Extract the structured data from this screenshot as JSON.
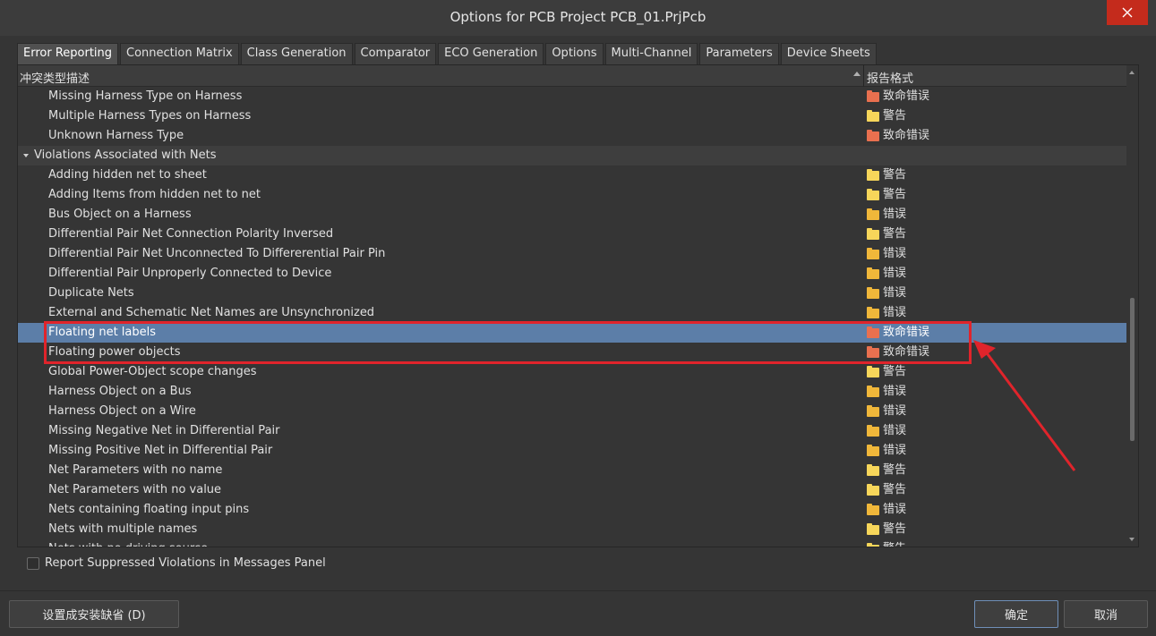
{
  "window": {
    "title": "Options for PCB Project PCB_01.PrjPcb"
  },
  "tabs": [
    "Error Reporting",
    "Connection Matrix",
    "Class Generation",
    "Comparator",
    "ECO Generation",
    "Options",
    "Multi-Channel",
    "Parameters",
    "Device Sheets"
  ],
  "active_tab": "Error Reporting",
  "table": {
    "col_description": "冲突类型描述",
    "col_report_mode": "报告格式",
    "rows": [
      {
        "name": "Missing Harness Type on Harness",
        "level": "致命错误",
        "severity": "fatal"
      },
      {
        "name": "Multiple Harness Types on Harness",
        "level": "警告",
        "severity": "warn"
      },
      {
        "name": "Unknown Harness Type",
        "level": "致命错误",
        "severity": "fatal"
      },
      {
        "name": "Violations Associated with Nets",
        "group": true
      },
      {
        "name": "Adding hidden net to sheet",
        "level": "警告",
        "severity": "warn"
      },
      {
        "name": "Adding Items from hidden net to net",
        "level": "警告",
        "severity": "warn"
      },
      {
        "name": "Bus Object on a Harness",
        "level": "错误",
        "severity": "error"
      },
      {
        "name": "Differential Pair Net Connection Polarity Inversed",
        "level": "警告",
        "severity": "warn"
      },
      {
        "name": "Differential Pair Net Unconnected To Differerential Pair Pin",
        "level": "错误",
        "severity": "error"
      },
      {
        "name": "Differential Pair Unproperly Connected to Device",
        "level": "错误",
        "severity": "error"
      },
      {
        "name": "Duplicate Nets",
        "level": "错误",
        "severity": "error"
      },
      {
        "name": "External and Schematic Net Names are Unsynchronized",
        "level": "错误",
        "severity": "error"
      },
      {
        "name": "Floating net labels",
        "level": "致命错误",
        "severity": "fatal",
        "selected": true
      },
      {
        "name": "Floating power objects",
        "level": "致命错误",
        "severity": "fatal"
      },
      {
        "name": "Global Power-Object scope changes",
        "level": "警告",
        "severity": "warn"
      },
      {
        "name": "Harness Object on a Bus",
        "level": "错误",
        "severity": "error"
      },
      {
        "name": "Harness Object on a Wire",
        "level": "错误",
        "severity": "error"
      },
      {
        "name": "Missing Negative Net in Differential Pair",
        "level": "错误",
        "severity": "error"
      },
      {
        "name": "Missing Positive Net in Differential Pair",
        "level": "错误",
        "severity": "error"
      },
      {
        "name": "Net Parameters with no name",
        "level": "警告",
        "severity": "warn"
      },
      {
        "name": "Net Parameters with no value",
        "level": "警告",
        "severity": "warn"
      },
      {
        "name": "Nets containing floating input pins",
        "level": "错误",
        "severity": "error"
      },
      {
        "name": "Nets with multiple names",
        "level": "警告",
        "severity": "warn"
      },
      {
        "name": "Nets with no driving source",
        "level": "警告",
        "severity": "warn"
      }
    ]
  },
  "report_suppressed": {
    "label": "Report Suppressed Violations in Messages Panel",
    "checked": false
  },
  "buttons": {
    "defaults": "设置成安装缺省 (D)",
    "ok": "确定",
    "cancel": "取消"
  },
  "colors": {
    "fatal": "#e9704f",
    "error": "#f0b73a",
    "warn": "#f7d65a",
    "selection": "#5c7ea8",
    "annotation": "#e0242b"
  }
}
